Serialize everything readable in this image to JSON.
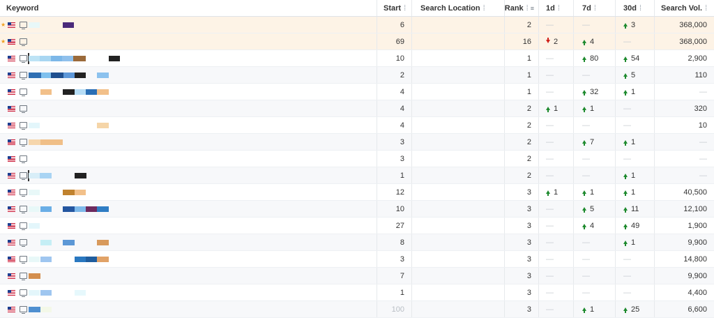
{
  "columns": {
    "keyword": "Keyword",
    "start": "Start",
    "location": "Search Location",
    "rank": "Rank",
    "d1": "1d",
    "d7": "7d",
    "d30": "30d",
    "volume": "Search Vol."
  },
  "empty": "—",
  "rows": [
    {
      "star": true,
      "start": "6",
      "rank": "2",
      "d1": null,
      "d7": null,
      "d30": {
        "dir": "up",
        "v": "3"
      },
      "vol": "368,000",
      "blocks": [
        {
          "c": "#e8f8f8",
          "l": 2,
          "w": 16
        },
        {
          "c": "#4a2a7a",
          "l": 51,
          "w": 16
        }
      ]
    },
    {
      "star": true,
      "start": "69",
      "rank": "16",
      "d1": {
        "dir": "down",
        "v": "2"
      },
      "d7": {
        "dir": "up",
        "v": "4"
      },
      "d30": null,
      "vol": "368,000",
      "blocks": []
    },
    {
      "start": "10",
      "rank": "1",
      "d1": null,
      "d7": {
        "dir": "up",
        "v": "80"
      },
      "d30": {
        "dir": "up",
        "v": "54"
      },
      "vol": "2,900",
      "cursor": true,
      "blocks": [
        {
          "c": "#bde3f5",
          "l": 2,
          "w": 16
        },
        {
          "c": "#a8d6f2",
          "l": 18,
          "w": 16
        },
        {
          "c": "#7cb7e8",
          "l": 34,
          "w": 16
        },
        {
          "c": "#8fc0ec",
          "l": 50,
          "w": 16
        },
        {
          "c": "#6ea6de",
          "l": 66,
          "w": 16
        },
        {
          "c": "#9b6a3a",
          "l": 66,
          "w": 18
        },
        {
          "c": "#222",
          "l": 117,
          "w": 16
        }
      ]
    },
    {
      "start": "2",
      "rank": "1",
      "d1": null,
      "d7": null,
      "d30": {
        "dir": "up",
        "v": "5"
      },
      "vol": "110",
      "blocks": [
        {
          "c": "#2f6fb3",
          "l": 2,
          "w": 18
        },
        {
          "c": "#7ec0ee",
          "l": 20,
          "w": 14
        },
        {
          "c": "#1f4f8f",
          "l": 34,
          "w": 18
        },
        {
          "c": "#5d97d8",
          "l": 52,
          "w": 16
        },
        {
          "c": "#222",
          "l": 68,
          "w": 16
        },
        {
          "c": "#8cc2ee",
          "l": 100,
          "w": 17
        }
      ]
    },
    {
      "start": "4",
      "rank": "1",
      "d1": null,
      "d7": {
        "dir": "up",
        "v": "32"
      },
      "d30": {
        "dir": "up",
        "v": "1"
      },
      "vol": null,
      "blocks": [
        {
          "c": "#f2c08a",
          "l": 19,
          "w": 16
        },
        {
          "c": "#222",
          "l": 51,
          "w": 17
        },
        {
          "c": "#b6ddf6",
          "l": 68,
          "w": 16
        },
        {
          "c": "#2a6fb5",
          "l": 84,
          "w": 16
        },
        {
          "c": "#f2c08a",
          "l": 100,
          "w": 17
        }
      ]
    },
    {
      "start": "4",
      "rank": "2",
      "d1": {
        "dir": "up",
        "v": "1"
      },
      "d7": {
        "dir": "up",
        "v": "1"
      },
      "d30": null,
      "vol": "320",
      "blocks": []
    },
    {
      "start": "4",
      "rank": "2",
      "d1": null,
      "d7": null,
      "d30": null,
      "vol": "10",
      "blocks": [
        {
          "c": "#e3f6fb",
          "l": 2,
          "w": 16
        },
        {
          "c": "#f5d5a8",
          "l": 100,
          "w": 17
        }
      ]
    },
    {
      "start": "3",
      "rank": "2",
      "d1": null,
      "d7": {
        "dir": "up",
        "v": "7"
      },
      "d30": {
        "dir": "up",
        "v": "1"
      },
      "vol": null,
      "blocks": [
        {
          "c": "#f6d6ac",
          "l": 2,
          "w": 17
        },
        {
          "c": "#f0bf88",
          "l": 19,
          "w": 32
        }
      ]
    },
    {
      "start": "3",
      "rank": "2",
      "d1": null,
      "d7": null,
      "d30": null,
      "vol": null,
      "blocks": []
    },
    {
      "start": "1",
      "rank": "2",
      "d1": null,
      "d7": null,
      "d30": {
        "dir": "up",
        "v": "1"
      },
      "vol": null,
      "cursor": true,
      "blocks": [
        {
          "c": "#d8eef8",
          "l": 2,
          "w": 16
        },
        {
          "c": "#a9d4f3",
          "l": 18,
          "w": 17
        },
        {
          "c": "#222",
          "l": 68,
          "w": 17
        }
      ]
    },
    {
      "start": "12",
      "rank": "3",
      "d1": {
        "dir": "up",
        "v": "1"
      },
      "d7": {
        "dir": "up",
        "v": "1"
      },
      "d30": {
        "dir": "up",
        "v": "1"
      },
      "vol": "40,500",
      "blocks": [
        {
          "c": "#e8f8f8",
          "l": 2,
          "w": 16
        },
        {
          "c": "#c0822e",
          "l": 51,
          "w": 17
        },
        {
          "c": "#f2c08a",
          "l": 68,
          "w": 16
        }
      ]
    },
    {
      "start": "10",
      "rank": "3",
      "d1": null,
      "d7": {
        "dir": "up",
        "v": "5"
      },
      "d30": {
        "dir": "up",
        "v": "11"
      },
      "vol": "12,100",
      "blocks": [
        {
          "c": "#e8f8f8",
          "l": 2,
          "w": 16
        },
        {
          "c": "#6aaee6",
          "l": 19,
          "w": 16
        },
        {
          "c": "#2456a0",
          "l": 51,
          "w": 17
        },
        {
          "c": "#7eb9ea",
          "l": 68,
          "w": 16
        },
        {
          "c": "#6d2a5e",
          "l": 84,
          "w": 16
        },
        {
          "c": "#2f7dc4",
          "l": 100,
          "w": 17
        }
      ]
    },
    {
      "start": "27",
      "rank": "3",
      "d1": null,
      "d7": {
        "dir": "up",
        "v": "4"
      },
      "d30": {
        "dir": "up",
        "v": "49"
      },
      "vol": "1,900",
      "blocks": [
        {
          "c": "#e3f6fb",
          "l": 2,
          "w": 16
        }
      ]
    },
    {
      "start": "8",
      "rank": "3",
      "d1": null,
      "d7": null,
      "d30": {
        "dir": "up",
        "v": "1"
      },
      "vol": "9,900",
      "blocks": [
        {
          "c": "#c5eef5",
          "l": 19,
          "w": 16
        },
        {
          "c": "#5c98d6",
          "l": 51,
          "w": 17
        },
        {
          "c": "#d89a5c",
          "l": 100,
          "w": 17
        }
      ]
    },
    {
      "start": "3",
      "rank": "3",
      "d1": null,
      "d7": null,
      "d30": null,
      "vol": "14,800",
      "blocks": [
        {
          "c": "#e8f8f8",
          "l": 2,
          "w": 16
        },
        {
          "c": "#9fc6f0",
          "l": 19,
          "w": 16
        },
        {
          "c": "#2a78c0",
          "l": 68,
          "w": 16
        },
        {
          "c": "#1f5d9e",
          "l": 84,
          "w": 16
        },
        {
          "c": "#e1a267",
          "l": 100,
          "w": 17
        }
      ]
    },
    {
      "start": "7",
      "rank": "3",
      "d1": null,
      "d7": null,
      "d30": null,
      "vol": "9,900",
      "blocks": [
        {
          "c": "#d38e4e",
          "l": 2,
          "w": 17
        }
      ]
    },
    {
      "start": "1",
      "rank": "3",
      "d1": null,
      "d7": null,
      "d30": null,
      "vol": "4,400",
      "blocks": [
        {
          "c": "#e3f6fb",
          "l": 2,
          "w": 16
        },
        {
          "c": "#9fc6f0",
          "l": 19,
          "w": 16
        },
        {
          "c": "#e6f8fc",
          "l": 68,
          "w": 16
        }
      ]
    },
    {
      "start": "100",
      "startFaded": true,
      "rank": "3",
      "d1": null,
      "d7": {
        "dir": "up",
        "v": "1"
      },
      "d30": {
        "dir": "up",
        "v": "25"
      },
      "vol": "6,600",
      "blocks": [
        {
          "c": "#4f8fd0",
          "l": 2,
          "w": 17
        },
        {
          "c": "#f3f8e8",
          "l": 19,
          "w": 16
        }
      ]
    }
  ]
}
